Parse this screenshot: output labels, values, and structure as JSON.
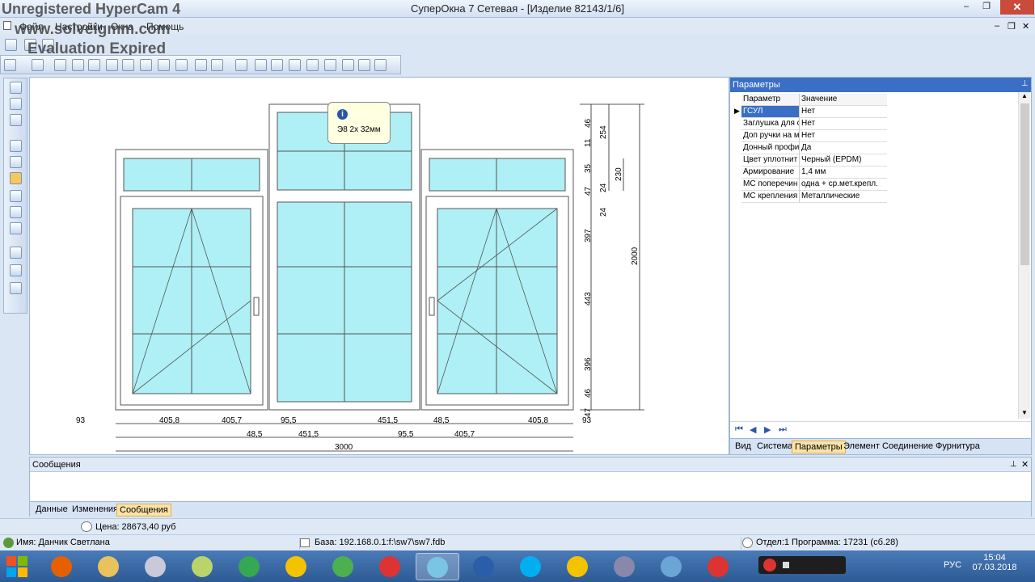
{
  "window": {
    "title": "СуперОкна 7 Сетевая - [Изделие 82143/1/6]",
    "min_label": "–",
    "max_label": "❐",
    "close_label": "✕",
    "doc_min": "–",
    "doc_max": "❐",
    "doc_close": "✕"
  },
  "watermark": {
    "line1": "Unregistered HyperCam 4",
    "line2": "www.solveigmm.com",
    "line3": "Evaluation Expired"
  },
  "menu": [
    "Файл",
    "Настройки",
    "Окна",
    "Помощь"
  ],
  "tooltip": {
    "text": "Э8 2х 32мм"
  },
  "dimensions": {
    "bottom_row1": [
      "93",
      "405,8",
      "405,7",
      "95,5",
      "451,5",
      "48,5",
      "405,8",
      "93"
    ],
    "bottom_row2": [
      "48,5",
      "451,5",
      "95,5",
      "405,7"
    ],
    "total_width": "3000",
    "right_col1": [
      "46",
      "11",
      "35",
      "47",
      "397",
      "443",
      "396",
      "46",
      "47"
    ],
    "right_col2": [
      "254",
      "24",
      "24"
    ],
    "right_col3": [
      "230"
    ],
    "total_height": "2000"
  },
  "params": {
    "header": "Параметры",
    "col_param": "Параметр",
    "col_value": "Значение",
    "rows": [
      {
        "name": "ГСУЛ",
        "value": "Нет"
      },
      {
        "name": "Заглушка для ст",
        "value": "Нет"
      },
      {
        "name": "Доп ручки на м",
        "value": "Нет"
      },
      {
        "name": "Донный профи",
        "value": "Да"
      },
      {
        "name": "Цвет уплотнит",
        "value": "Черный (EPDM)"
      },
      {
        "name": "Армирование",
        "value": "1,4 мм"
      },
      {
        "name": "МС поперечин",
        "value": "одна + ср.мет.крепл."
      },
      {
        "name": "МС крепления",
        "value": "Металлические"
      }
    ],
    "nav": [
      "⏮",
      "◀",
      "▶",
      "⏭"
    ],
    "tabs": [
      "Вид",
      "Система",
      "Параметры",
      "Элемент",
      "Соединение",
      "Фурнитура"
    ],
    "active_tab": "Параметры"
  },
  "messages": {
    "header": "Сообщения",
    "tabs": [
      "Данные",
      "Изменения",
      "Сообщения"
    ],
    "active_tab": "Сообщения"
  },
  "price": {
    "label": "Цена: 28673,40 руб"
  },
  "status": {
    "user": "Имя: Данчик Светлана",
    "base": "База: 192.168.0.1:f:\\sw7\\sw7.fdb",
    "dept": "Отдел:1 Программа: 17231 (сб.28)"
  },
  "taskbar": {
    "lang": "РУС",
    "time": "15:04",
    "date": "07.03.2018"
  },
  "colors": {
    "glass": "#aef0f5",
    "accent": "#3b6fc5",
    "active_tab": "#fbe2a8"
  }
}
